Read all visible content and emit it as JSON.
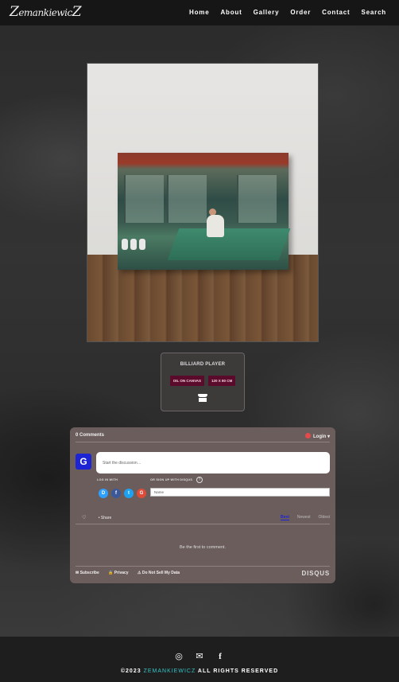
{
  "header": {
    "logo_text": "Zemankiewicz",
    "nav": [
      "Home",
      "About",
      "Gallery",
      "Order",
      "Contact",
      "Search"
    ]
  },
  "artwork": {
    "title": "BILLIARD PLAYER",
    "tags": [
      "OIL ON CANVAS",
      "120 X 80 CM"
    ],
    "shop_icon": "shop-icon"
  },
  "comments": {
    "count_label": "0 Comments",
    "login_label": "Login",
    "avatar_letter": "G",
    "input_placeholder": "Start the discussion…",
    "login_with_label": "LOG IN WITH",
    "signup_label": "OR SIGN UP WITH DISQUS",
    "name_placeholder": "Name",
    "social": [
      {
        "letter": "D",
        "color": "#2e9fff"
      },
      {
        "letter": "f",
        "color": "#3b5998"
      },
      {
        "letter": "t",
        "color": "#1da1f2"
      },
      {
        "letter": "G",
        "color": "#dd4b39"
      }
    ],
    "share_label": "Share",
    "sort": [
      "Best",
      "Newest",
      "Oldest"
    ],
    "empty_message": "Be the first to comment.",
    "footer_items": [
      "Subscribe",
      "Privacy",
      "Do Not Sell My Data"
    ],
    "brand": "DISQUS"
  },
  "footer": {
    "icons": [
      "instagram-icon",
      "mail-icon",
      "facebook-icon"
    ],
    "copyright_prefix": "©2023",
    "copyright_brand": "ZEMANKIEWICZ",
    "copyright_suffix": "ALL RIGHTS RESERVED"
  },
  "colors": {
    "tag_bg": "#5a0a2a",
    "disqus_blue": "#1d24d4",
    "brand_teal": "#35c4c4"
  }
}
